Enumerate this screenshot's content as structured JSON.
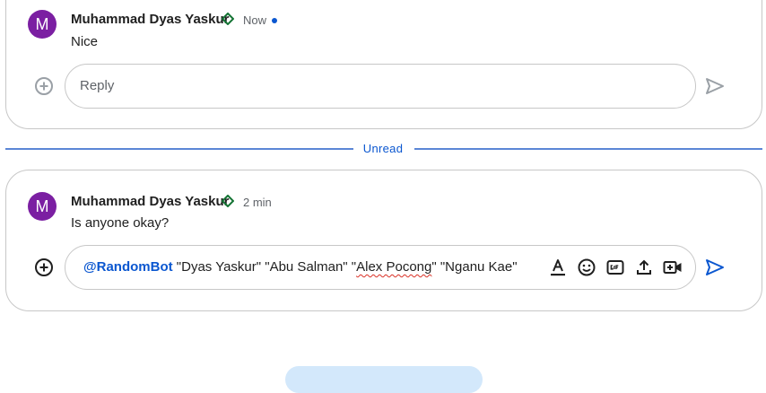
{
  "thread1": {
    "avatar_letter": "M",
    "sender": "Muhammad Dyas Yaskur",
    "time": "Now",
    "message": "Nice",
    "reply_placeholder": "Reply"
  },
  "divider": {
    "label": "Unread"
  },
  "thread2": {
    "avatar_letter": "M",
    "sender": "Muhammad Dyas Yaskur",
    "time": "2 min",
    "message": "Is anyone okay?",
    "draft": {
      "mention": "@RandomBot",
      "text_before": " \"Dyas Yaskur\" \"Abu Salman\" \"",
      "misspelled": "Alex Pocong",
      "text_after": "\" \"Nganu Kae\""
    }
  },
  "icons": {
    "add": "add-circle-icon",
    "send": "send-icon",
    "format": "text-format-icon",
    "emoji": "emoji-icon",
    "gif": "gif-icon",
    "upload": "upload-icon",
    "video": "video-call-icon",
    "status": "diamond-status-icon"
  },
  "colors": {
    "avatar": "#7b1fa2",
    "accent": "#0b57d0",
    "status_diamond": "#137333",
    "send_disabled": "#9aa0a6"
  }
}
